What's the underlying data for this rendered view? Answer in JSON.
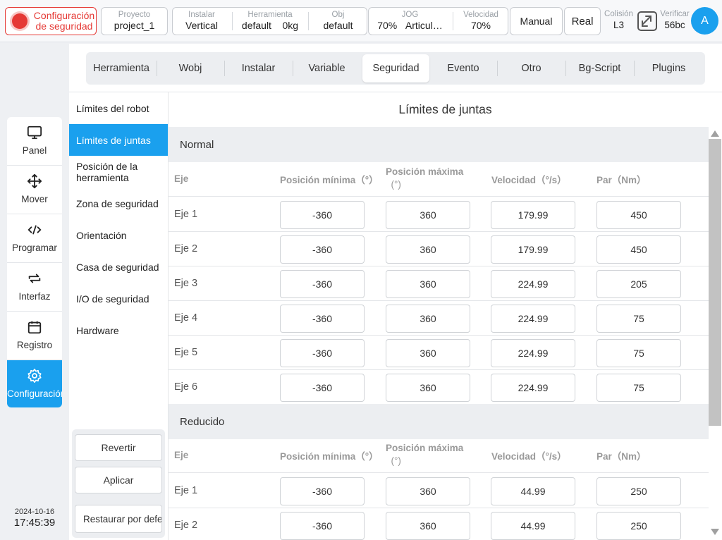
{
  "topbar": {
    "safety_label_1": "Configuración",
    "safety_label_2": "de seguridad",
    "project_label": "Proyecto",
    "project_value": "project_1",
    "install_label": "Instalar",
    "install_value": "Vertical",
    "tool_label": "Herramienta",
    "tool_value": "default",
    "tool_weight": "0kg",
    "obj_label": "Obj",
    "obj_value": "default",
    "jog_label": "JOG",
    "jog_speed": "70%",
    "jog_mode": "Articul…",
    "speed_label": "Velocidad",
    "speed_value": "70%",
    "mode_button": "Manual",
    "real_button": "Real",
    "collision_label": "Colisión",
    "collision_value": "L3",
    "verify_label": "Verificar",
    "verify_value": "56bc",
    "avatar_letter": "A"
  },
  "leftnav": {
    "items": [
      {
        "label": "Panel",
        "icon": "monitor-icon"
      },
      {
        "label": "Mover",
        "icon": "move-icon"
      },
      {
        "label": "Programar",
        "icon": "code-icon"
      },
      {
        "label": "Interfaz",
        "icon": "interface-icon"
      },
      {
        "label": "Registro",
        "icon": "calendar-icon"
      },
      {
        "label": "Configuración",
        "icon": "gear-icon"
      }
    ],
    "active_index": 5,
    "date": "2024-10-16",
    "time": "17:45:39"
  },
  "tabs": [
    "Herramienta",
    "Wobj",
    "Instalar",
    "Variable",
    "Seguridad",
    "Evento",
    "Otro",
    "Bg-Script",
    "Plugins"
  ],
  "active_tab": "Seguridad",
  "subnav": {
    "items": [
      "Límites del robot",
      "Límites de juntas",
      "Posición de la herramienta",
      "Zona de seguridad",
      "Orientación",
      "Casa de seguridad",
      "I/O de seguridad",
      "Hardware"
    ],
    "active_index": 1,
    "revert_button": "Revertir",
    "apply_button": "Aplicar",
    "restore_button": "Restaurar por defecto"
  },
  "content": {
    "title": "Límites de juntas",
    "headers": {
      "axis": "Eje",
      "min_pos": "Posición mínima（°）",
      "max_pos_1": "Posición máxima",
      "max_pos_2": "(°)",
      "speed": "Velocidad（°/s）",
      "torque": "Par（Nm）"
    },
    "normal": {
      "label": "Normal",
      "rows": [
        {
          "axis": "Eje 1",
          "min": "-360",
          "max": "360",
          "speed": "179.99",
          "torque": "450"
        },
        {
          "axis": "Eje 2",
          "min": "-360",
          "max": "360",
          "speed": "179.99",
          "torque": "450"
        },
        {
          "axis": "Eje 3",
          "min": "-360",
          "max": "360",
          "speed": "224.99",
          "torque": "205"
        },
        {
          "axis": "Eje 4",
          "min": "-360",
          "max": "360",
          "speed": "224.99",
          "torque": "75"
        },
        {
          "axis": "Eje 5",
          "min": "-360",
          "max": "360",
          "speed": "224.99",
          "torque": "75"
        },
        {
          "axis": "Eje 6",
          "min": "-360",
          "max": "360",
          "speed": "224.99",
          "torque": "75"
        }
      ]
    },
    "reduced": {
      "label": "Reducido",
      "rows": [
        {
          "axis": "Eje 1",
          "min": "-360",
          "max": "360",
          "speed": "44.99",
          "torque": "250"
        },
        {
          "axis": "Eje 2",
          "min": "-360",
          "max": "360",
          "speed": "44.99",
          "torque": "250"
        }
      ]
    }
  },
  "colors": {
    "accent": "#1aa0ee",
    "alert": "#e53935"
  }
}
